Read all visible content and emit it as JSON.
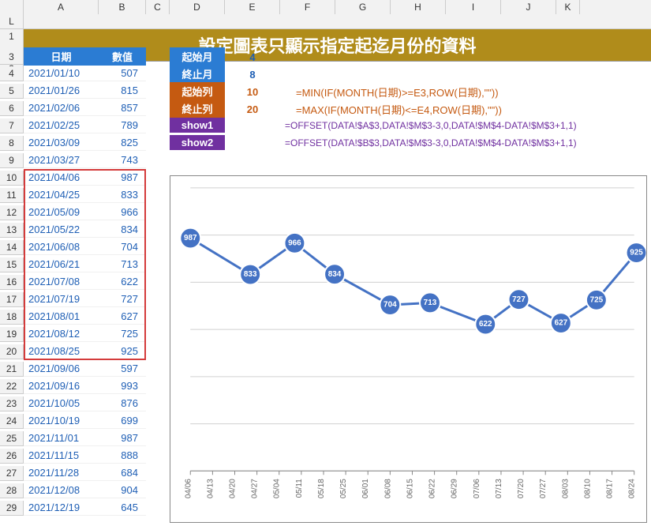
{
  "title": "設定圖表只顯示指定起迄月份的資料",
  "col_headers": [
    "",
    "A",
    "B",
    "C",
    "D",
    "E",
    "F",
    "G",
    "H",
    "I",
    "J",
    "K",
    "L"
  ],
  "table_headers": {
    "date": "日期",
    "value": "數值"
  },
  "rows": [
    {
      "n": "4",
      "d": "2021/01/10",
      "v": "507"
    },
    {
      "n": "5",
      "d": "2021/01/26",
      "v": "815"
    },
    {
      "n": "6",
      "d": "2021/02/06",
      "v": "857"
    },
    {
      "n": "7",
      "d": "2021/02/25",
      "v": "789"
    },
    {
      "n": "8",
      "d": "2021/03/09",
      "v": "825"
    },
    {
      "n": "9",
      "d": "2021/03/27",
      "v": "743"
    },
    {
      "n": "10",
      "d": "2021/04/06",
      "v": "987"
    },
    {
      "n": "11",
      "d": "2021/04/25",
      "v": "833"
    },
    {
      "n": "12",
      "d": "2021/05/09",
      "v": "966"
    },
    {
      "n": "13",
      "d": "2021/05/22",
      "v": "834"
    },
    {
      "n": "14",
      "d": "2021/06/08",
      "v": "704"
    },
    {
      "n": "15",
      "d": "2021/06/21",
      "v": "713"
    },
    {
      "n": "16",
      "d": "2021/07/08",
      "v": "622"
    },
    {
      "n": "17",
      "d": "2021/07/19",
      "v": "727"
    },
    {
      "n": "18",
      "d": "2021/08/01",
      "v": "627"
    },
    {
      "n": "19",
      "d": "2021/08/12",
      "v": "725"
    },
    {
      "n": "20",
      "d": "2021/08/25",
      "v": "925"
    },
    {
      "n": "21",
      "d": "2021/09/06",
      "v": "597"
    },
    {
      "n": "22",
      "d": "2021/09/16",
      "v": "993"
    },
    {
      "n": "23",
      "d": "2021/10/05",
      "v": "876"
    },
    {
      "n": "24",
      "d": "2021/10/19",
      "v": "699"
    },
    {
      "n": "25",
      "d": "2021/11/01",
      "v": "987"
    },
    {
      "n": "26",
      "d": "2021/11/15",
      "v": "888"
    },
    {
      "n": "27",
      "d": "2021/11/28",
      "v": "684"
    },
    {
      "n": "28",
      "d": "2021/12/08",
      "v": "904"
    },
    {
      "n": "29",
      "d": "2021/12/19",
      "v": "645"
    }
  ],
  "highlight": {
    "start_row": 6,
    "end_row": 16
  },
  "params": [
    {
      "n": "3",
      "label": "起始月",
      "val": "4",
      "cls": "hdr-blue",
      "vcls": "blue-val",
      "f": ""
    },
    {
      "n": "4",
      "label": "終止月",
      "val": "8",
      "cls": "hdr-blue",
      "vcls": "blue-val",
      "f": ""
    },
    {
      "n": "5",
      "label": "起始列",
      "val": "10",
      "cls": "hdr-orange",
      "vcls": "orange-val",
      "f": "=MIN(IF(MONTH(日期)>=E3,ROW(日期),\"\"))",
      "fcls": "orange-formula"
    },
    {
      "n": "6",
      "label": "終止列",
      "val": "20",
      "cls": "hdr-orange",
      "vcls": "orange-val",
      "f": "=MAX(IF(MONTH(日期)<=E4,ROW(日期),\"\"))",
      "fcls": "orange-formula"
    },
    {
      "n": "7",
      "label": "show1",
      "val": "",
      "cls": "hdr-purple",
      "vcls": "",
      "f": "=OFFSET(DATA!$A$3,DATA!$M$3-3,0,DATA!$M$4-DATA!$M$3+1,1)",
      "fcls": "purple-formula"
    },
    {
      "n": "8",
      "label": "show2",
      "val": "",
      "cls": "hdr-purple",
      "vcls": "",
      "f": "=OFFSET(DATA!$B$3,DATA!$M$3-3,0,DATA!$M$4-DATA!$M$3+1,1)",
      "fcls": "purple-formula"
    }
  ],
  "chart_data": {
    "type": "line",
    "categories": [
      "04/06",
      "04/13",
      "04/20",
      "04/27",
      "05/04",
      "05/11",
      "05/18",
      "05/25",
      "06/01",
      "06/08",
      "06/15",
      "06/22",
      "06/29",
      "07/06",
      "07/13",
      "07/20",
      "07/27",
      "08/03",
      "08/10",
      "08/17",
      "08/24"
    ],
    "points": [
      {
        "x": 0,
        "v": 987,
        "l": "987"
      },
      {
        "x": 2.7,
        "v": 833,
        "l": "833"
      },
      {
        "x": 4.7,
        "v": 966,
        "l": "966"
      },
      {
        "x": 6.5,
        "v": 834,
        "l": "834"
      },
      {
        "x": 9.0,
        "v": 704,
        "l": "704"
      },
      {
        "x": 10.8,
        "v": 713,
        "l": "713"
      },
      {
        "x": 13.3,
        "v": 622,
        "l": "622"
      },
      {
        "x": 14.8,
        "v": 727,
        "l": "727"
      },
      {
        "x": 16.7,
        "v": 627,
        "l": "627"
      },
      {
        "x": 18.3,
        "v": 725,
        "l": "725"
      },
      {
        "x": 20.1,
        "v": 925,
        "l": "925"
      }
    ],
    "ylim": [
      0,
      1200
    ]
  }
}
